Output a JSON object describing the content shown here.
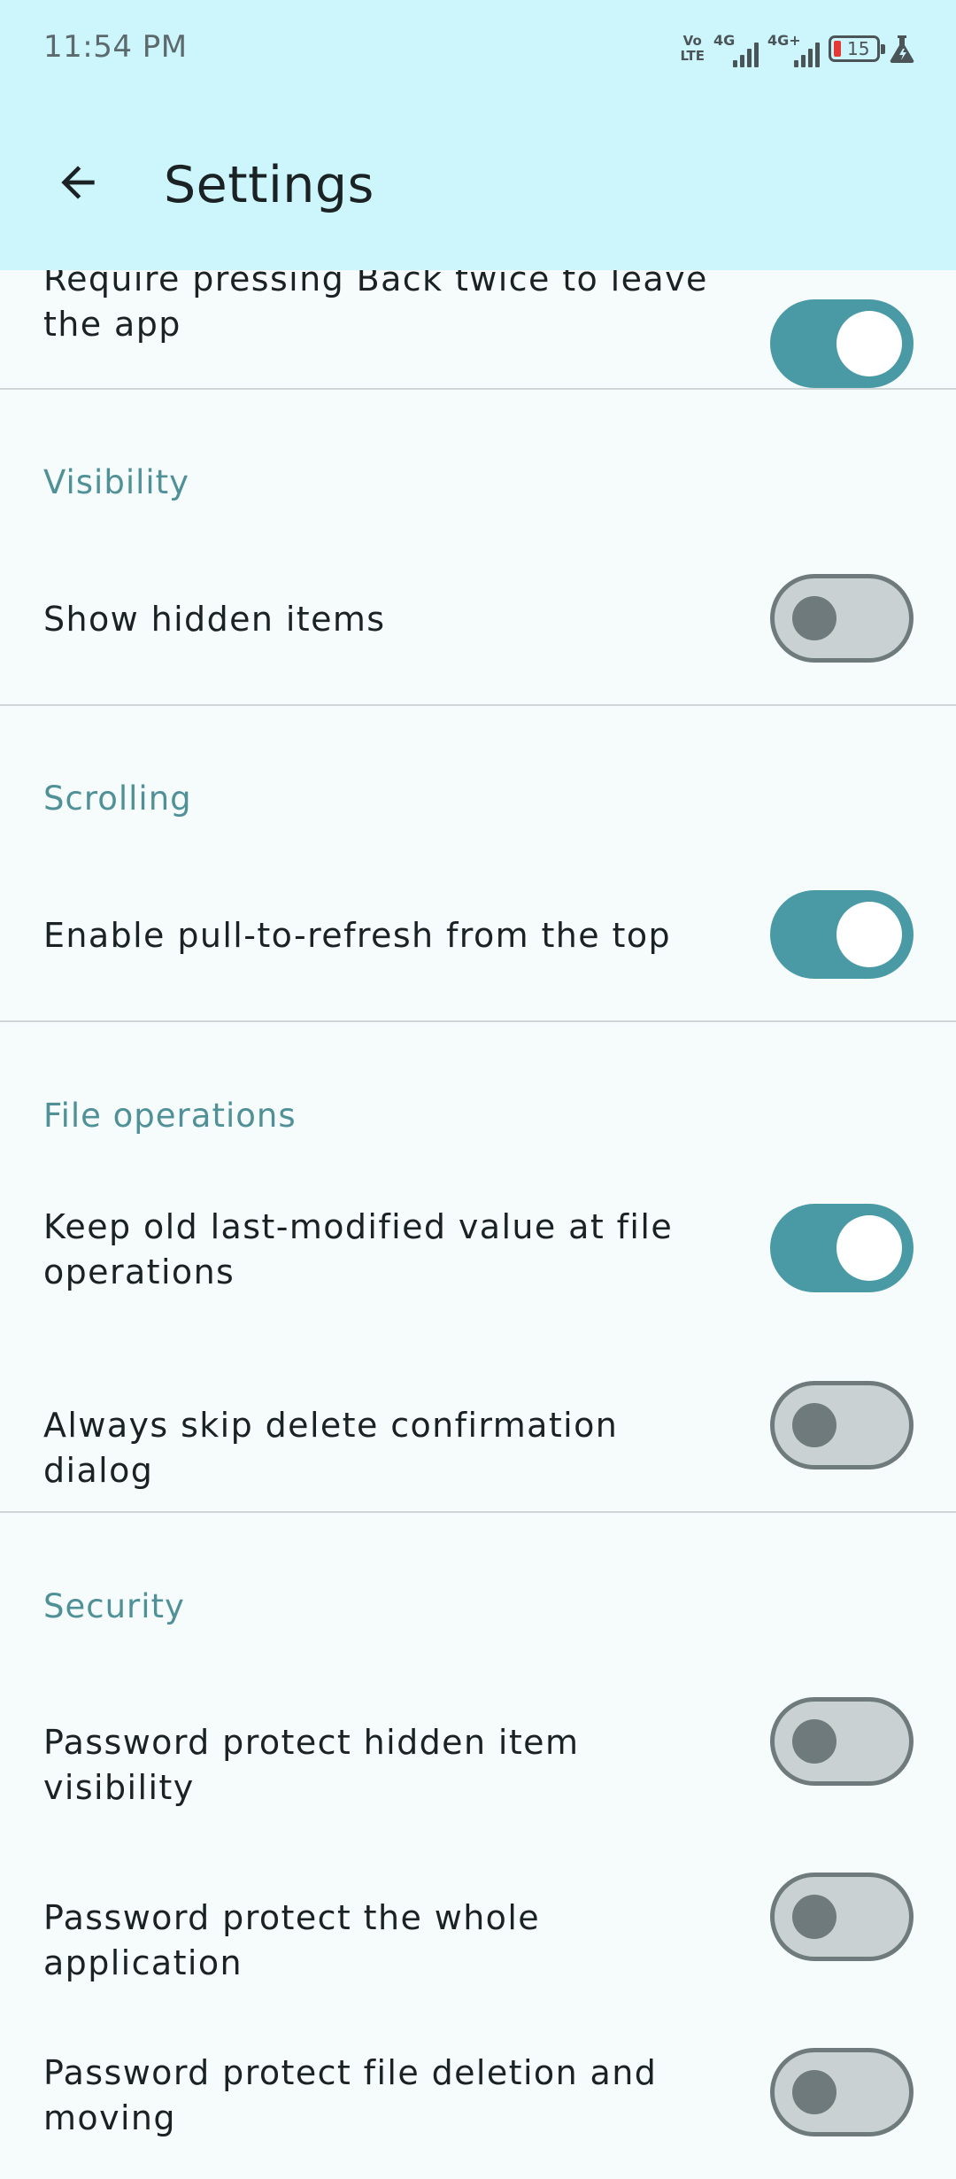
{
  "status_bar": {
    "time": "11:54 PM",
    "volte_top": "Vo",
    "volte_bottom": "LTE",
    "net1_label": "4G",
    "net2_label": "4G+",
    "battery_level": "15",
    "icons": [
      "volte-icon",
      "signal-4g-icon",
      "signal-4g-plus-icon",
      "battery-icon",
      "flask-icon"
    ],
    "battery_low_color": "#e53935"
  },
  "app_bar": {
    "title": "Settings",
    "back_icon": "arrow-back-icon",
    "background": "#cdf5fc"
  },
  "colors": {
    "accent": "#4a9aa5",
    "section_header": "#4f9197",
    "switch_off_track": "#c9d1d2",
    "switch_off_border": "#6e7a7c"
  },
  "settings": {
    "press_back_twice": {
      "label": "Require pressing Back twice to leave the app",
      "enabled": true
    },
    "visibility": {
      "header": "Visibility",
      "show_hidden": {
        "label": "Show hidden items",
        "enabled": false
      }
    },
    "scrolling": {
      "header": "Scrolling",
      "pull_to_refresh": {
        "label": "Enable pull-to-refresh from the top",
        "enabled": true
      }
    },
    "file_operations": {
      "header": "File operations",
      "keep_last_modified": {
        "label": "Keep old last-modified value at file operations",
        "enabled": true
      },
      "skip_delete_confirmation": {
        "label": "Always skip delete confirmation dialog",
        "enabled": false
      }
    },
    "security": {
      "header": "Security",
      "protect_hidden": {
        "label": "Password protect hidden item visibility",
        "enabled": false
      },
      "protect_app": {
        "label": "Password protect the whole application",
        "enabled": false
      },
      "protect_deletion": {
        "label": "Password protect file deletion and moving",
        "enabled": false
      }
    }
  }
}
